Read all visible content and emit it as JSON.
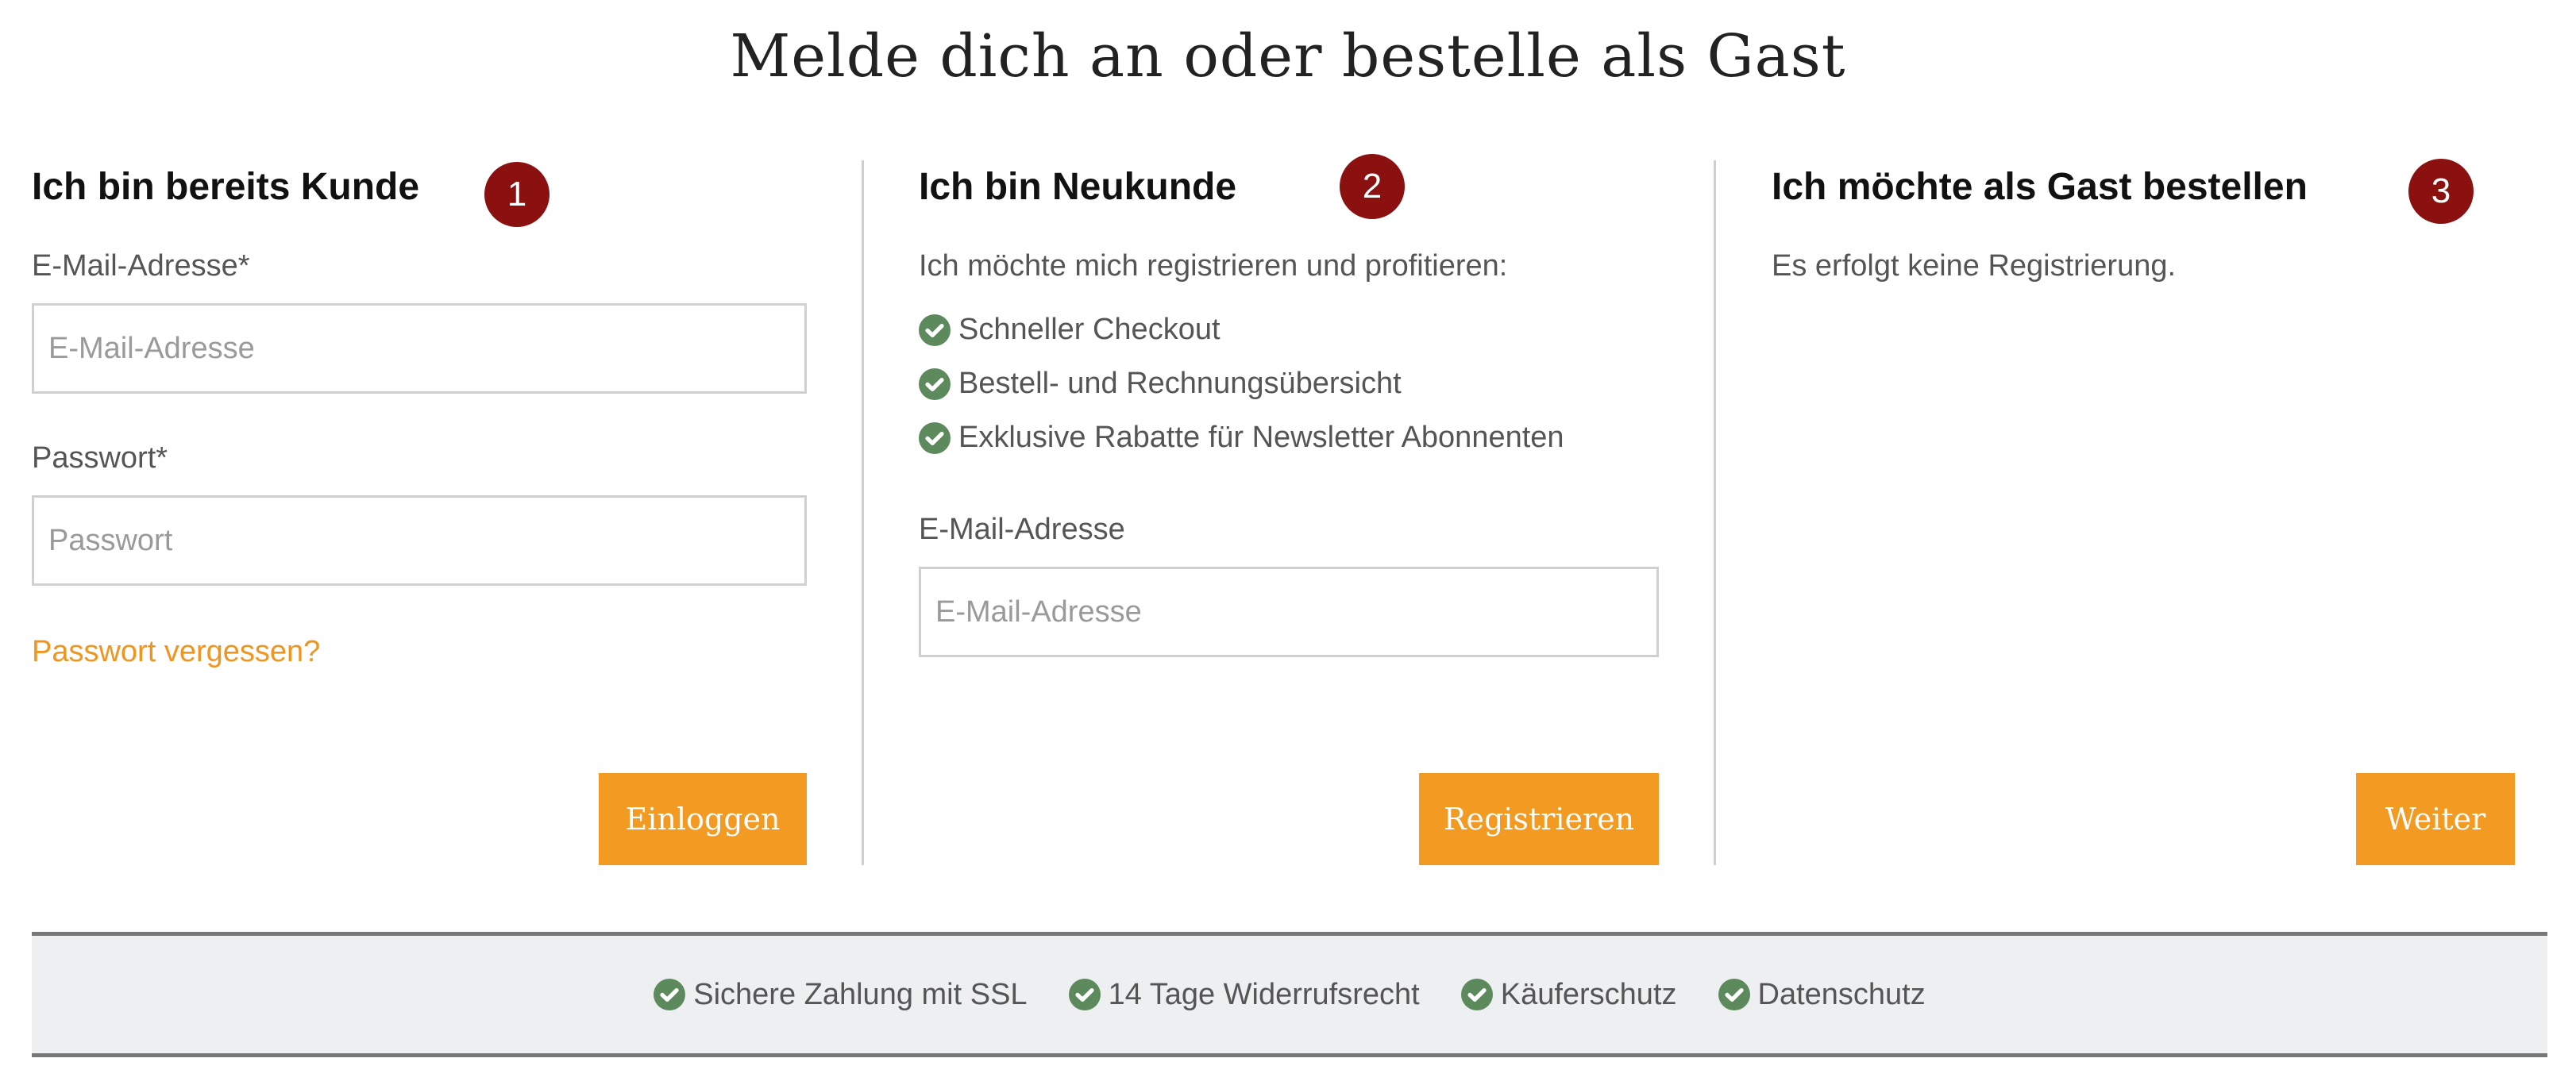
{
  "page_title": "Melde dich an oder bestelle als Gast",
  "colors": {
    "accent": "#f39a23",
    "badge": "#8b1010",
    "check": "#5c8a5c",
    "link": "#f0951f"
  },
  "existing_customer": {
    "title": "Ich bin bereits Kunde",
    "step": "1",
    "email_label": "E-Mail-Adresse*",
    "email_placeholder": "E-Mail-Adresse",
    "password_label": "Passwort*",
    "password_placeholder": "Passwort",
    "forgot_link": "Passwort vergessen?",
    "login_button": "Einloggen"
  },
  "new_customer": {
    "title": "Ich bin Neukunde",
    "step": "2",
    "intro": "Ich möchte mich registrieren und profitieren:",
    "benefits": [
      "Schneller Checkout",
      "Bestell- und Rechnungsübersicht",
      "Exklusive Rabatte für Newsletter Abonnenten"
    ],
    "email_label": "E-Mail-Adresse",
    "email_placeholder": "E-Mail-Adresse",
    "register_button": "Registrieren"
  },
  "guest": {
    "title": "Ich möchte als Gast bestellen",
    "step": "3",
    "intro": "Es erfolgt keine Registrierung.",
    "continue_button": "Weiter"
  },
  "trust_bar": {
    "items": [
      "Sichere Zahlung mit SSL",
      "14 Tage Widerrufsrecht",
      "Käuferschutz",
      "Datenschutz"
    ],
    "icon": "check-circle-icon"
  }
}
